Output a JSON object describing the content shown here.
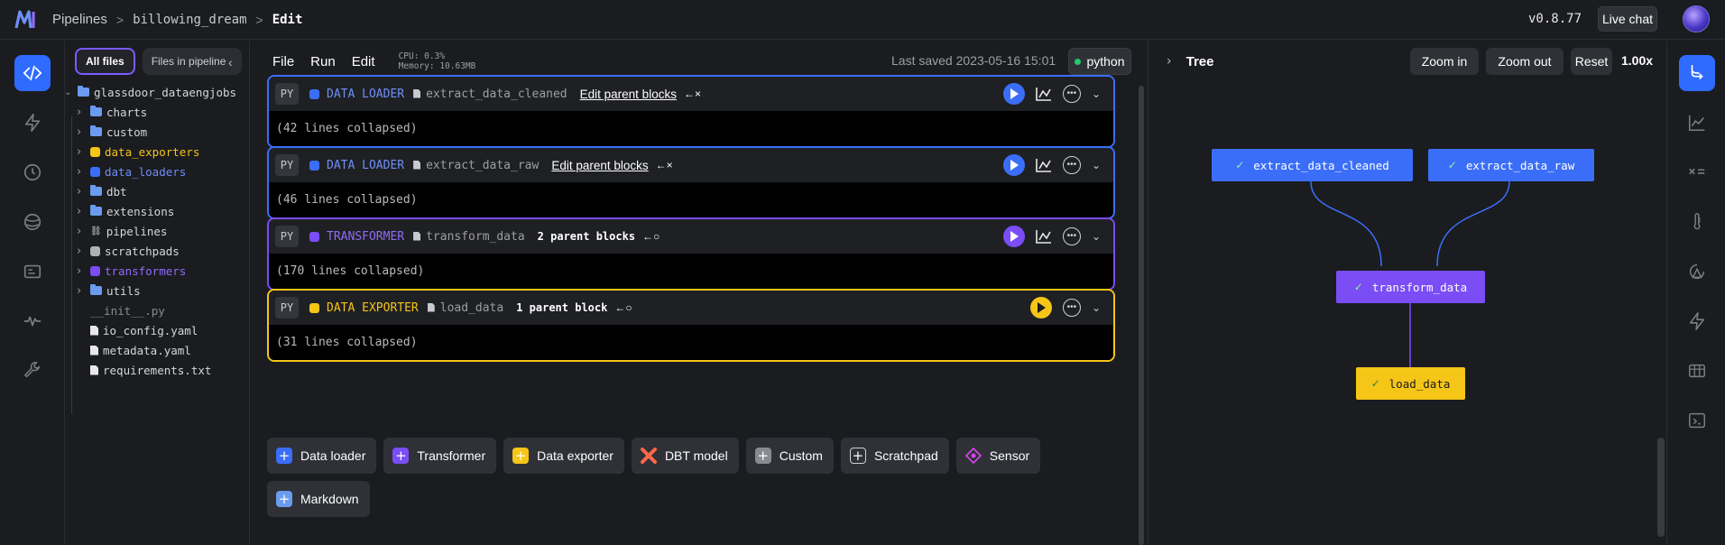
{
  "header": {
    "breadcrumbs": [
      "Pipelines",
      "billowing_dream"
    ],
    "current": "Edit",
    "version": "v0.8.77",
    "live_chat": "Live chat"
  },
  "left_rail": {
    "icons": [
      "code-icon",
      "lightning-icon",
      "clock-icon",
      "globe-icon",
      "terminal-icon",
      "pulse-icon",
      "wrench-icon"
    ]
  },
  "file_tree": {
    "tabs": [
      "All files",
      "Files in pipeline"
    ],
    "root": "glassdoor_dataengjobs",
    "items": [
      {
        "label": "charts",
        "kind": "folder",
        "color": "#6b9bef",
        "text_color": "#d5d6d9",
        "expandable": true
      },
      {
        "label": "custom",
        "kind": "folder",
        "color": "#6b9bef",
        "text_color": "#d5d6d9",
        "expandable": true
      },
      {
        "label": "data_exporters",
        "kind": "dot",
        "color": "#f5c518",
        "text_color": "#f5c518",
        "expandable": true
      },
      {
        "label": "data_loaders",
        "kind": "dot",
        "color": "#3b6ef8",
        "text_color": "#6f8ff7",
        "expandable": true
      },
      {
        "label": "dbt",
        "kind": "folder",
        "color": "#6b9bef",
        "text_color": "#d5d6d9",
        "expandable": true
      },
      {
        "label": "extensions",
        "kind": "folder",
        "color": "#6b9bef",
        "text_color": "#d5d6d9",
        "expandable": true
      },
      {
        "label": "pipelines",
        "kind": "pipeline",
        "color": "#d5d6d9",
        "text_color": "#d5d6d9",
        "expandable": true
      },
      {
        "label": "scratchpads",
        "kind": "dot",
        "color": "#b0b1b5",
        "text_color": "#d5d6d9",
        "expandable": true
      },
      {
        "label": "transformers",
        "kind": "dot",
        "color": "#7a4df5",
        "text_color": "#8e6cf7",
        "expandable": true
      },
      {
        "label": "utils",
        "kind": "folder",
        "color": "#6b9bef",
        "text_color": "#d5d6d9",
        "expandable": true
      },
      {
        "label": "__init__.py",
        "kind": "none",
        "color": "#8a8b90",
        "text_color": "#8a8b90",
        "expandable": false
      },
      {
        "label": "io_config.yaml",
        "kind": "file",
        "color": "#e8e8ea",
        "text_color": "#d5d6d9",
        "expandable": false
      },
      {
        "label": "metadata.yaml",
        "kind": "file",
        "color": "#e8e8ea",
        "text_color": "#d5d6d9",
        "expandable": false
      },
      {
        "label": "requirements.txt",
        "kind": "file",
        "color": "#e8e8ea",
        "text_color": "#d5d6d9",
        "expandable": false
      }
    ]
  },
  "editor": {
    "menu": [
      "File",
      "Run",
      "Edit"
    ],
    "cpu": "CPU: 0.3%",
    "memory": "Memory: 10.63MB",
    "last_saved": "Last saved 2023-05-16 15:01",
    "kernel": "python",
    "blocks": [
      {
        "lang": "PY",
        "type": "DATA LOADER",
        "name": "extract_data_cleaned",
        "parents": "Edit parent blocks",
        "parents_style": "edit",
        "connector": "←×",
        "collapsed": "(42 lines collapsed)",
        "color": "#3b6ef8",
        "type_color": "#6f8ff7",
        "show_chart": true
      },
      {
        "lang": "PY",
        "type": "DATA LOADER",
        "name": "extract_data_raw",
        "parents": "Edit parent blocks",
        "parents_style": "edit",
        "connector": "←×",
        "collapsed": "(46 lines collapsed)",
        "color": "#3b6ef8",
        "type_color": "#6f8ff7",
        "show_chart": true
      },
      {
        "lang": "PY",
        "type": "TRANSFORMER",
        "name": "transform_data",
        "parents": "2 parent blocks",
        "parents_style": "count",
        "connector": "←○",
        "collapsed": "(170 lines collapsed)",
        "color": "#7a4df5",
        "type_color": "#8e6cf7",
        "show_chart": true
      },
      {
        "lang": "PY",
        "type": "DATA EXPORTER",
        "name": "load_data",
        "parents": "1 parent block",
        "parents_style": "count",
        "connector": "←○",
        "collapsed": "(31 lines collapsed)",
        "color": "#f5c518",
        "type_color": "#f5c518",
        "show_chart": false
      }
    ],
    "add_buttons": [
      {
        "label": "Data loader",
        "icon": "plus-icon",
        "color": "#3b6ef8"
      },
      {
        "label": "Transformer",
        "icon": "plus-icon",
        "color": "#7a4df5"
      },
      {
        "label": "Data exporter",
        "icon": "plus-icon",
        "color": "#f5c518"
      },
      {
        "label": "DBT model",
        "icon": "dbt-icon",
        "color": "#ff694a"
      },
      {
        "label": "Custom",
        "icon": "plus-icon",
        "color": "#8a8b90"
      },
      {
        "label": "Scratchpad",
        "icon": "plus-icon",
        "color": "#2f3137"
      },
      {
        "label": "Sensor",
        "icon": "sensor-icon",
        "color": "#d946ef"
      },
      {
        "label": "Markdown",
        "icon": "plus-icon",
        "color": "#6b9bef"
      }
    ]
  },
  "tree_panel": {
    "title": "Tree",
    "zoom_in": "Zoom in",
    "zoom_out": "Zoom out",
    "reset": "Reset",
    "zoom_level": "1.00x",
    "nodes": [
      {
        "label": "extract_data_cleaned",
        "color": "#3b6ef8",
        "text": "#ffffff"
      },
      {
        "label": "extract_data_raw",
        "color": "#3b6ef8",
        "text": "#ffffff"
      },
      {
        "label": "transform_data",
        "color": "#7a4df5",
        "text": "#ffffff"
      },
      {
        "label": "load_data",
        "color": "#f5c518",
        "text": "#1b1c20"
      }
    ]
  },
  "right_rail": {
    "icons": [
      "tree-icon",
      "chart-icon",
      "variables-icon",
      "thermometer-icon",
      "settings-icon",
      "lightning-icon",
      "table-icon",
      "terminal-icon"
    ]
  }
}
